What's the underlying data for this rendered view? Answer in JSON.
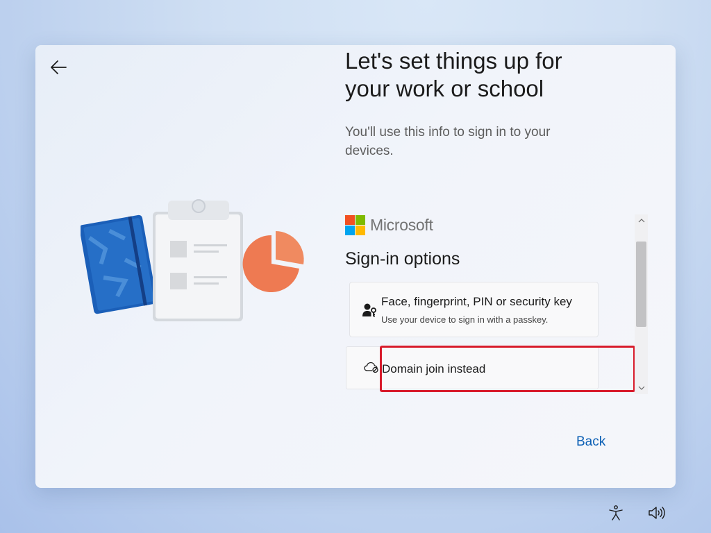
{
  "header": {
    "title": "Let's set things up for your work or school",
    "subtitle": "You'll use this info to sign in to your devices."
  },
  "brand": {
    "name": "Microsoft",
    "logo_colors": [
      "#f25022",
      "#7fba00",
      "#00a4ef",
      "#ffb900"
    ]
  },
  "signin": {
    "heading": "Sign-in options",
    "options": [
      {
        "icon": "person-key-icon",
        "title": "Face, fingerprint, PIN or security key",
        "description": "Use your device to sign in with a passkey."
      },
      {
        "icon": "cloud-blocked-icon",
        "title": "Domain join instead"
      }
    ]
  },
  "footer": {
    "back_label": "Back"
  },
  "taskbar": {
    "icons": [
      "accessibility-icon",
      "volume-icon"
    ]
  },
  "colors": {
    "accent": "#0a5fb4",
    "highlight": "#d81b2b"
  }
}
